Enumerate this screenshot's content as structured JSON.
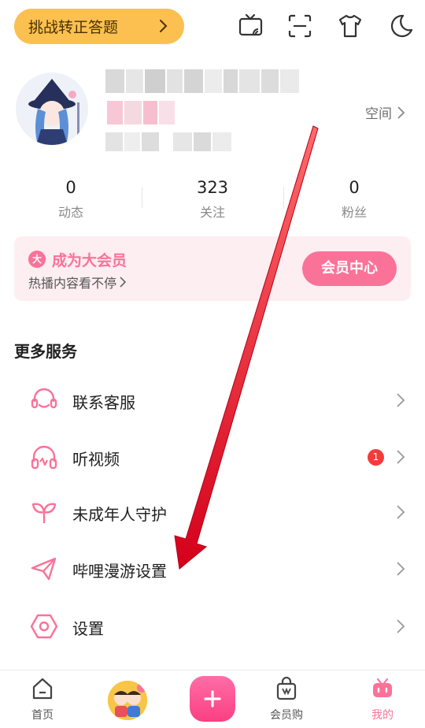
{
  "topbar": {
    "challenge_label": "挑战转正答题",
    "icons": [
      "tv-cast-icon",
      "scan-icon",
      "tshirt-icon",
      "moon-icon"
    ]
  },
  "profile": {
    "space_label": "空间"
  },
  "stats": [
    {
      "value": "0",
      "label": "动态"
    },
    {
      "value": "323",
      "label": "关注"
    },
    {
      "value": "0",
      "label": "粉丝"
    }
  ],
  "vip": {
    "badge": "大",
    "title": "成为大会员",
    "subtitle": "热播内容看不停",
    "button": "会员中心"
  },
  "services": {
    "title": "更多服务",
    "items": [
      {
        "label": "联系客服",
        "icon": "headset-icon"
      },
      {
        "label": "听视频",
        "icon": "headphones-icon",
        "badge": "1"
      },
      {
        "label": "未成年人守护",
        "icon": "sprout-icon"
      },
      {
        "label": "哔哩漫游设置",
        "icon": "paper-plane-icon"
      },
      {
        "label": "设置",
        "icon": "gear-icon"
      }
    ]
  },
  "nav": {
    "home": "首页",
    "vip_shop": "会员购",
    "mine": "我的"
  },
  "colors": {
    "accent": "#fb7299",
    "challenge": "#fbc04f",
    "badge_red": "#f23c3c",
    "annotation_arrow": "#e8001c"
  }
}
